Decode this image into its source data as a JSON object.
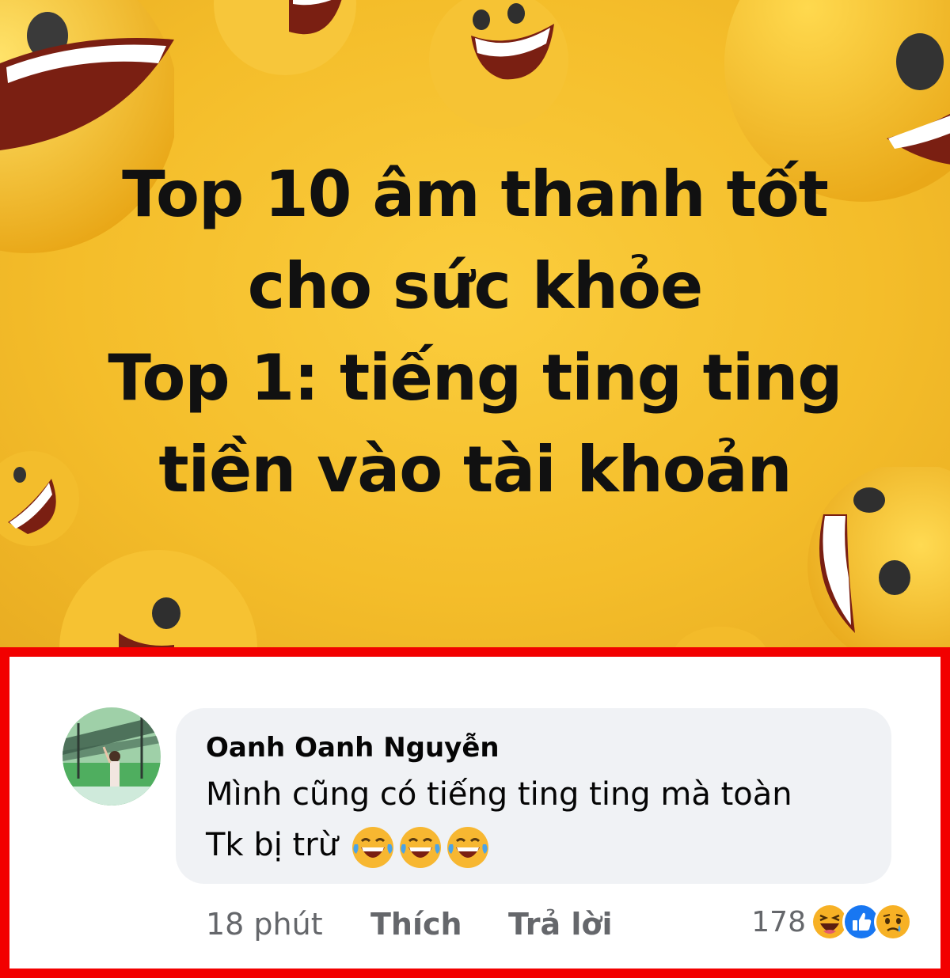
{
  "meme": {
    "lines": [
      "Top 10 âm thanh tốt",
      "cho sức khỏe",
      "Top 1: tiếng ting ting",
      "tiền vào tài khoản"
    ]
  },
  "comment": {
    "author": "Oanh Oanh Nguyễn",
    "line1": "Mình cũng có tiếng ting ting mà toàn",
    "line2": "Tk bị trừ",
    "emojis": [
      "laugh-cry-emoji",
      "laugh-cry-emoji",
      "laugh-cry-emoji"
    ],
    "time": "18 phút",
    "like_label": "Thích",
    "reply_label": "Trả lời",
    "reaction_count": "178",
    "reaction_icons": [
      "haha-icon",
      "like-icon",
      "sad-icon"
    ]
  },
  "colors": {
    "highlight_border": "#f20000",
    "bubble_bg": "#f0f2f5",
    "muted_text": "#65676b",
    "meme_bg": "#f4bd2a",
    "like_blue": "#1877f2"
  }
}
